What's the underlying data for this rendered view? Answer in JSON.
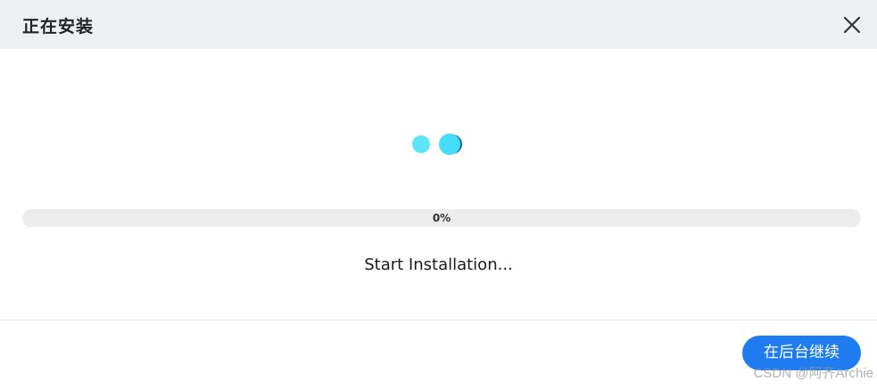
{
  "dialog": {
    "title": "正在安装",
    "close_icon": "close-icon"
  },
  "spinner": {
    "icon": "loading-dots-icon",
    "colors": [
      "#5ee4f8",
      "#3dd8f4",
      "#1a5f9e"
    ]
  },
  "progress": {
    "value": 0,
    "label": "0%",
    "fill_color": "#1f7cf0"
  },
  "status": {
    "text": "Start Installation..."
  },
  "footer": {
    "continue_label": "在后台继续",
    "button_color": "#1f7cf0"
  },
  "watermark": {
    "text": "CSDN @阿齐Archie"
  }
}
